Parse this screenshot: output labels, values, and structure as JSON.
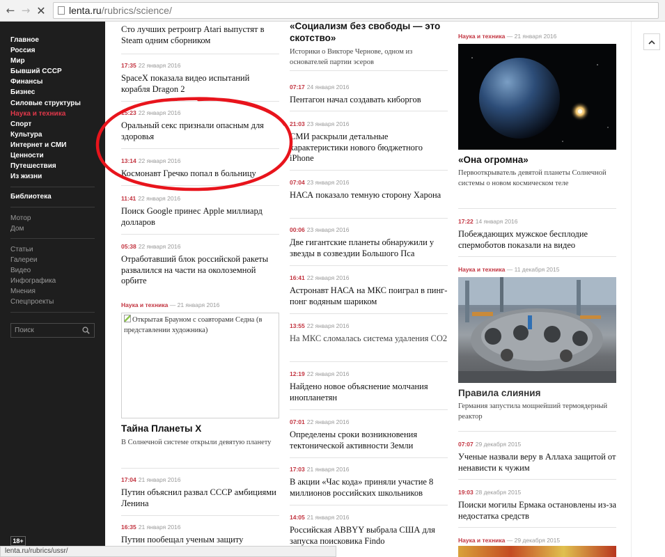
{
  "browser": {
    "url_host": "lenta.ru",
    "url_path": "/rubrics/science/",
    "status_url": "lenta.ru/rubrics/ussr/"
  },
  "sidebar": {
    "menu": [
      "Главное",
      "Россия",
      "Мир",
      "Бывший СССР",
      "Финансы",
      "Бизнес",
      "Силовые структуры",
      "Наука и техника",
      "Спорт",
      "Культура",
      "Интернет и СМИ",
      "Ценности",
      "Путешествия",
      "Из жизни"
    ],
    "active_item": "Наука и техника",
    "library": "Библиотека",
    "group2": [
      "Мотор",
      "Дом"
    ],
    "group3": [
      "Статьи",
      "Галереи",
      "Видео",
      "Инфографика",
      "Мнения",
      "Спецпроекты"
    ],
    "search_placeholder": "Поиск",
    "age_badge": "18+"
  },
  "col1": {
    "top_title": "Сто лучших ретроигр Atari выпустят в Steam одним сборником",
    "items": [
      {
        "time": "17:35",
        "date": "22 января 2016",
        "title": "SpaceX показала видео испытаний корабля Dragon 2"
      },
      {
        "time": "15:23",
        "date": "22 января 2016",
        "title": "Оральный секс признали опасным для здоровья"
      },
      {
        "time": "13:14",
        "date": "22 января 2016",
        "title": "Космонавт Гречко попал в больницу"
      },
      {
        "time": "11:41",
        "date": "22 января 2016",
        "title": "Поиск Google принес Apple миллиард долларов"
      },
      {
        "time": "05:38",
        "date": "22 января 2016",
        "title": "Отработавший блок российской ракеты развалился на части на околоземной орбите"
      }
    ],
    "feature": {
      "rubric": "Наука и техника",
      "date": "21 января 2016",
      "image_alt": "Открытая Брауном с соавторами Седна (в представлении художника)",
      "title": "Тайна Планеты Х",
      "subtitle": "В Солнечной системе открыли девятую планету"
    },
    "items2": [
      {
        "time": "17:04",
        "date": "21 января 2016",
        "title": "Путин объяснил развал СССР амбициями Ленина"
      },
      {
        "time": "16:35",
        "date": "21 января 2016",
        "title": "Путин пообещал ученым защиту"
      }
    ]
  },
  "col2": {
    "lead_title": "«Социализм без свободы — это скотство»",
    "lead_sub": "Историки о Викторе Чернове, одном из основателей партии эсеров",
    "items": [
      {
        "time": "07:17",
        "date": "24 января 2016",
        "title": "Пентагон начал создавать киборгов"
      },
      {
        "time": "21:03",
        "date": "23 января 2016",
        "title": "СМИ раскрыли детальные характеристики нового бюджетного iPhone"
      },
      {
        "time": "07:04",
        "date": "23 января 2016",
        "title": "НАСА показало темную сторону Харона"
      },
      {
        "time": "00:06",
        "date": "23 января 2016",
        "title": "Две гигантские планеты обнаружили у звезды в созвездии Большого Пса"
      },
      {
        "time": "16:41",
        "date": "22 января 2016",
        "title": "Астронавт НАСА на МКС поиграл в пинг-понг водяным шариком"
      },
      {
        "time": "13:55",
        "date": "22 января 2016",
        "title": "На МКС сломалась система удаления CO2"
      },
      {
        "time": "12:19",
        "date": "22 января 2016",
        "title": "Найдено новое объяснение молчания инопланетян"
      },
      {
        "time": "07:01",
        "date": "22 января 2016",
        "title": "Определены сроки возникновения тектонической активности Земли"
      },
      {
        "time": "17:03",
        "date": "21 января 2016",
        "title": "В акции «Час кода» приняли участие 8 миллионов российских школьников"
      },
      {
        "time": "14:05",
        "date": "21 января 2016",
        "title": "Российская ABBYY выбрала США для запуска поисковика Findo"
      }
    ]
  },
  "col3": {
    "feature1": {
      "rubric": "Наука и техника",
      "date": "21 января 2016",
      "title": "«Она огромна»",
      "subtitle": "Первооткрыватель девятой планеты Солнечной системы о новом космическом теле"
    },
    "item1": {
      "time": "17:22",
      "date": "14 января 2016",
      "title": "Побеждающих мужское бесплодие спермоботов показали на видео"
    },
    "feature2": {
      "rubric": "Наука и техника",
      "date": "11 декабря 2015",
      "title": "Правила слияния",
      "subtitle": "Германия запустила мощнейший термоядерный реактор"
    },
    "item2": {
      "time": "07:07",
      "date": "29 декабря 2015",
      "title": "Ученые назвали веру в Аллаха защитой от ненависти к чужим"
    },
    "item3": {
      "time": "19:03",
      "date": "28 декабря 2015",
      "title": "Поиски могилы Ермака остановлены из-за недостатка средств"
    },
    "feature3": {
      "rubric": "Наука и техника",
      "date": "29 декабря 2015"
    }
  },
  "colors": {
    "accent": "#c2333f",
    "sidebar_bg": "#1e1e1e",
    "annotation": "#e8141c"
  },
  "icons": [
    "back-arrow-icon",
    "forward-arrow-icon",
    "stop-icon",
    "page-icon",
    "search-icon",
    "chevron-up-icon",
    "broken-image-icon"
  ]
}
